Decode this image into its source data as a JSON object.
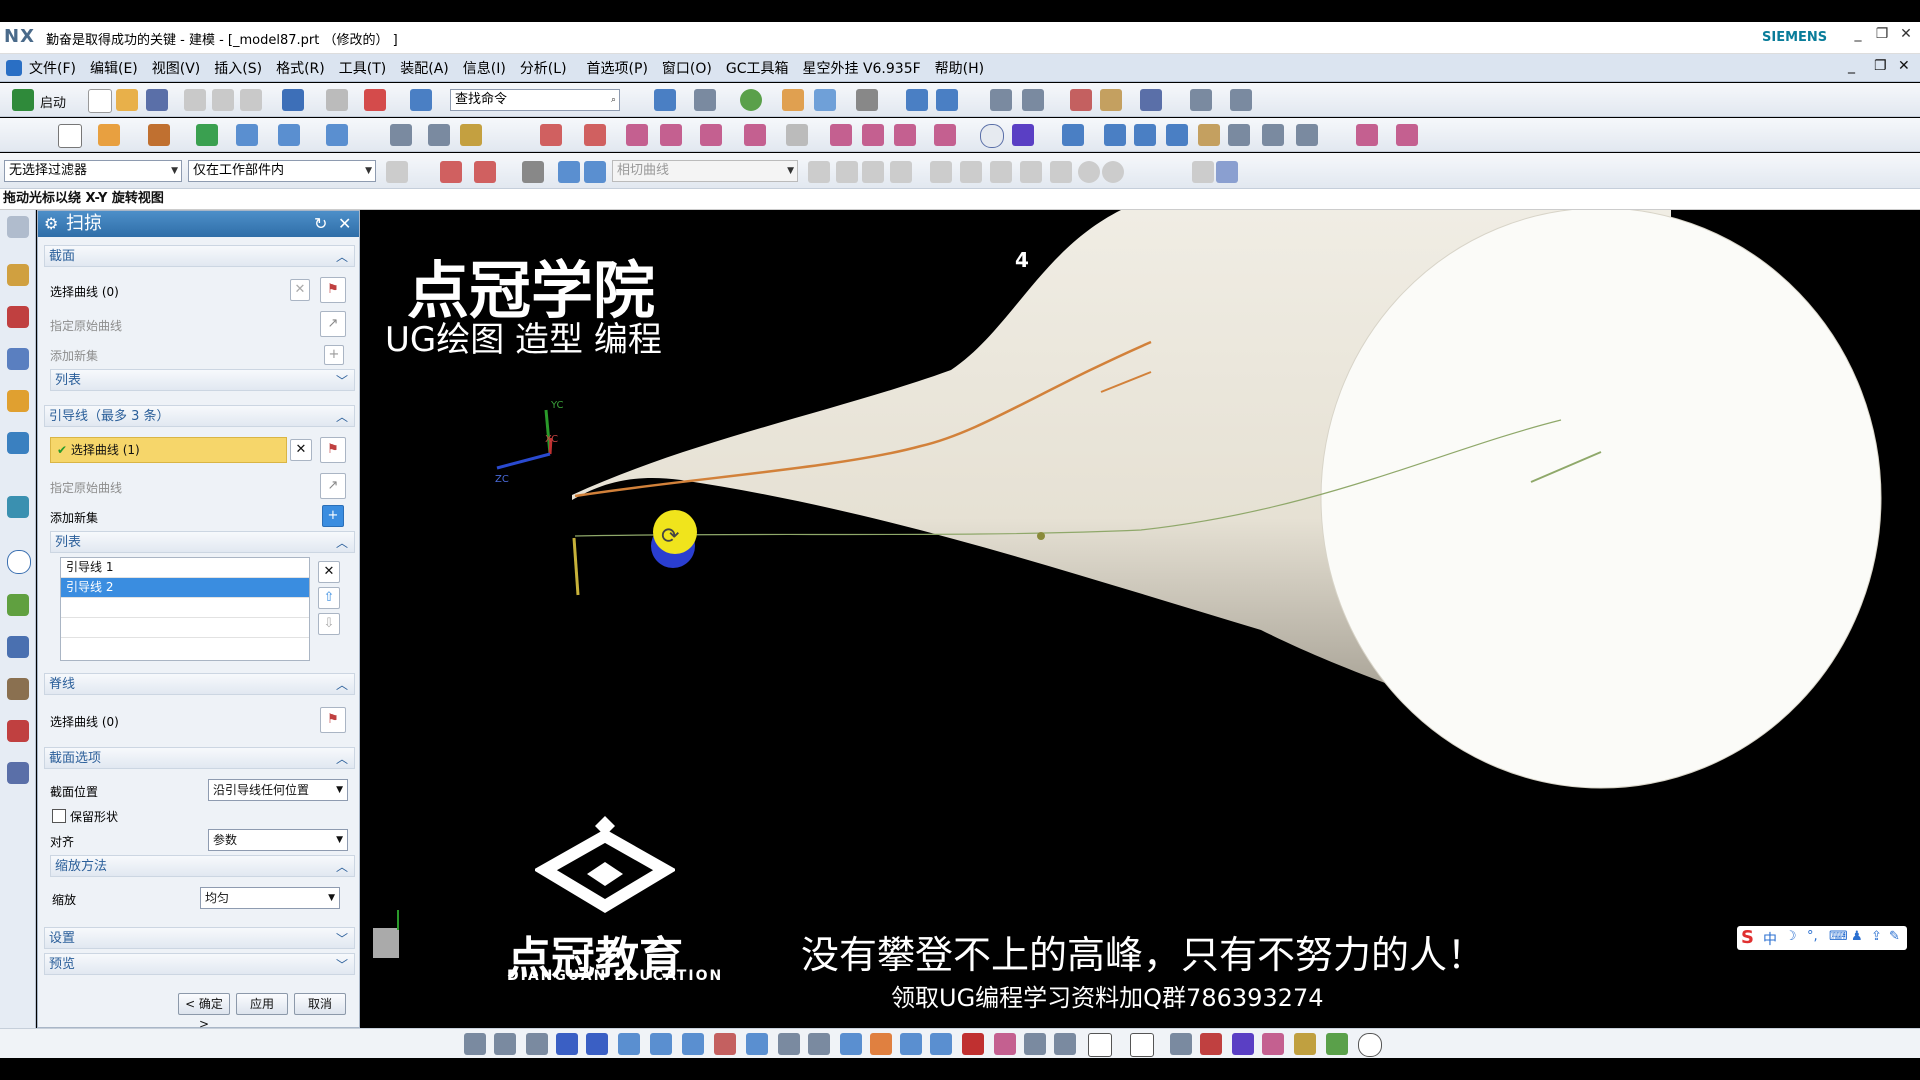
{
  "window": {
    "app_logo": "NX",
    "title": "勤奋是取得成功的关键 - 建模 - [_model87.prt （修改的） ]",
    "brand": "SIEMENS",
    "controls": [
      "_",
      "❐",
      "✕"
    ]
  },
  "menu": {
    "items": [
      "文件(F)",
      "编辑(E)",
      "视图(V)",
      "插入(S)",
      "格式(R)",
      "工具(T)",
      "装配(A)",
      "信息(I)",
      "分析(L)",
      "首选项(P)",
      "窗口(O)",
      "GC工具箱",
      "星空外挂 V6.935F",
      "帮助(H)"
    ]
  },
  "toolbar": {
    "start_label": "启动",
    "search_placeholder": "查找命令",
    "filter_value": "无选择过滤器",
    "scope_value": "仅在工作部件内",
    "curve_rule_value": "相切曲线"
  },
  "status": {
    "prompt": "拖动光标以绕 X-Y 旋转视图"
  },
  "dialog": {
    "title": "扫掠",
    "section": {
      "header": "截面",
      "select_curve": "选择曲线 (0)",
      "specify_origin": "指定原始曲线",
      "add_new": "添加新集",
      "list_header": "列表"
    },
    "guide": {
      "header": "引导线（最多 3 条）",
      "select_curve": "选择曲线 (1)",
      "specify_origin": "指定原始曲线",
      "add_new": "添加新集",
      "list_header": "列表",
      "items": [
        "引导线 1",
        "引导线 2"
      ],
      "selected_index": 1
    },
    "spine": {
      "header": "脊线",
      "select_curve": "选择曲线 (0)"
    },
    "section_options": {
      "header": "截面选项",
      "position_label": "截面位置",
      "position_value": "沿引导线任何位置",
      "keep_shape_label": "保留形状",
      "keep_shape_checked": false,
      "align_label": "对齐",
      "align_value": "参数",
      "scaling_header": "缩放方法",
      "scale_label": "缩放",
      "scale_value": "均匀"
    },
    "settings_header": "设置",
    "preview_header": "预览",
    "buttons": {
      "ok": "< 确定 >",
      "apply": "应用",
      "cancel": "取消"
    }
  },
  "viewport": {
    "watermark_title": "点冠学院",
    "watermark_sub": "UG绘图 造型 编程",
    "page_number": "4",
    "axis_labels": [
      "YC",
      "XC",
      "ZC"
    ],
    "logo_cn": "点冠教育",
    "logo_en": "DIANGUAN EDUCATION",
    "slogan": "没有攀登不上的高峰，只有不努力的人！",
    "contact": "领取UG编程学习资料加Q群786393274",
    "ime_label": "中"
  },
  "colors": {
    "dialog_header": "#2f6ea8",
    "highlight": "#f6d66a",
    "selection": "#3a8de0",
    "surface": "#f4f1e8",
    "guide_curve": "#d2813a"
  }
}
